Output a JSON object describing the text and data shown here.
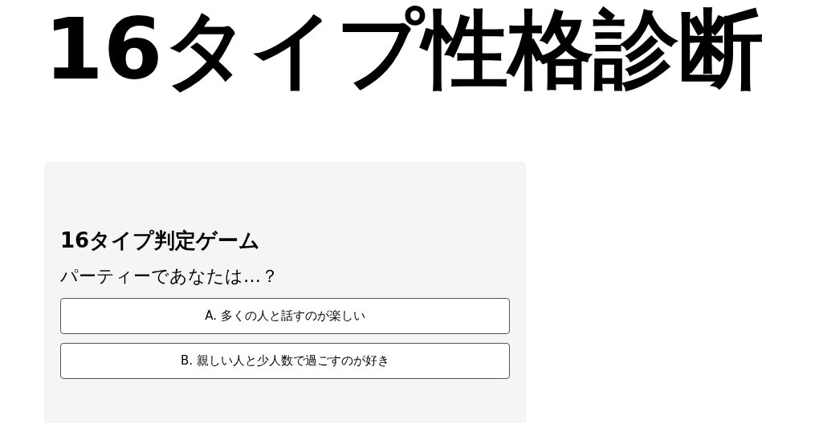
{
  "title": "16タイプ性格診断",
  "game": {
    "heading": "16タイプ判定ゲーム",
    "question": "パーティーであなたは…？",
    "options": [
      "A. 多くの人と話すのが楽しい",
      "B. 親しい人と少人数で過ごすのが好き"
    ]
  }
}
